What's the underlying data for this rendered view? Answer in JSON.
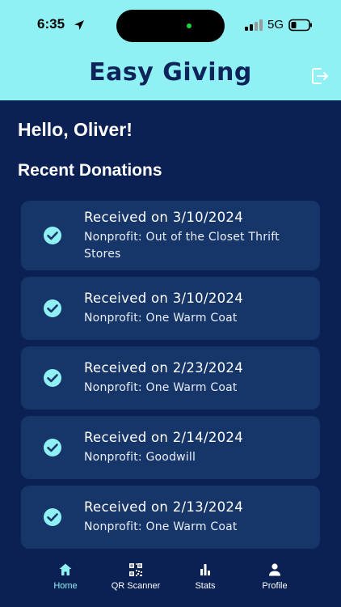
{
  "status_bar": {
    "time": "6:35",
    "network": "5G"
  },
  "header": {
    "title": "Easy Giving",
    "logout_icon": "logout-icon"
  },
  "greeting": "Hello, Oliver!",
  "section_title": "Recent Donations",
  "donations": [
    {
      "title": "Received on 3/10/2024",
      "nonprofit": "Nonprofit: Out of the Closet Thrift Stores"
    },
    {
      "title": "Received on 3/10/2024",
      "nonprofit": "Nonprofit: One Warm Coat"
    },
    {
      "title": "Received on 2/23/2024",
      "nonprofit": "Nonprofit: One Warm Coat"
    },
    {
      "title": "Received on 2/14/2024",
      "nonprofit": "Nonprofit: Goodwill"
    },
    {
      "title": "Received on 2/13/2024",
      "nonprofit": "Nonprofit: One Warm Coat"
    }
  ],
  "tabs": [
    {
      "label": "Home",
      "icon": "home-icon",
      "active": true
    },
    {
      "label": "QR Scanner",
      "icon": "qr-code-icon",
      "active": false
    },
    {
      "label": "Stats",
      "icon": "bar-chart-icon",
      "active": false
    },
    {
      "label": "Profile",
      "icon": "person-icon",
      "active": false
    }
  ],
  "colors": {
    "header_bg": "#8ff1f4",
    "page_bg": "#0b2154",
    "card_bg": "#163569",
    "accent": "#8ff1f4"
  }
}
